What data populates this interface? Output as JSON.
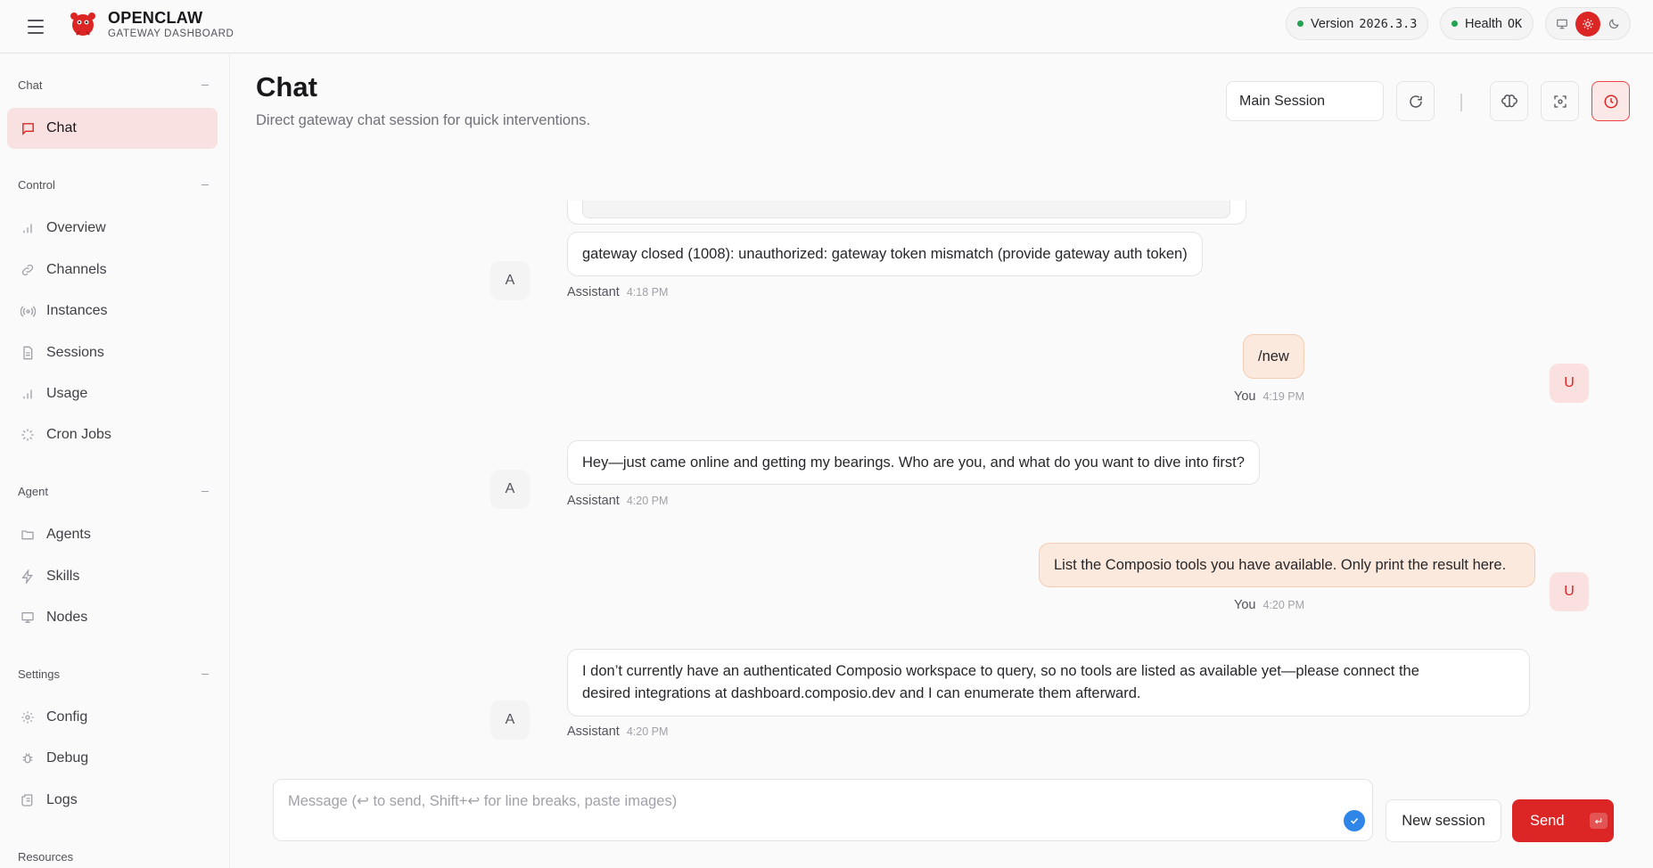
{
  "header": {
    "brand_title": "OPENCLAW",
    "brand_subtitle": "GATEWAY DASHBOARD",
    "version_label": "Version",
    "version_value": "2026.3.3",
    "health_label": "Health",
    "health_value": "OK",
    "status_color": "#22a352",
    "accent_color": "#dc2626",
    "theme_icons": [
      "monitor-icon",
      "sun-icon",
      "moon-icon"
    ]
  },
  "sidebar": {
    "sections": [
      {
        "title": "Chat",
        "items": [
          {
            "label": "Chat",
            "icon": "chat-bubble-icon",
            "active": true
          }
        ]
      },
      {
        "title": "Control",
        "items": [
          {
            "label": "Overview",
            "icon": "bar-chart-icon"
          },
          {
            "label": "Channels",
            "icon": "link-icon"
          },
          {
            "label": "Instances",
            "icon": "radio-icon"
          },
          {
            "label": "Sessions",
            "icon": "file-icon"
          },
          {
            "label": "Usage",
            "icon": "bar-chart-icon"
          },
          {
            "label": "Cron Jobs",
            "icon": "loader-icon"
          }
        ]
      },
      {
        "title": "Agent",
        "items": [
          {
            "label": "Agents",
            "icon": "folder-icon"
          },
          {
            "label": "Skills",
            "icon": "zap-icon"
          },
          {
            "label": "Nodes",
            "icon": "monitor-icon"
          }
        ]
      },
      {
        "title": "Settings",
        "items": [
          {
            "label": "Config",
            "icon": "gear-icon"
          },
          {
            "label": "Debug",
            "icon": "bug-icon"
          },
          {
            "label": "Logs",
            "icon": "scroll-icon"
          }
        ]
      },
      {
        "title": "Resources",
        "items": []
      }
    ]
  },
  "main": {
    "title": "Chat",
    "subtitle": "Direct gateway chat session for quick interventions.",
    "session_select": "Main Session",
    "toolbar_icons": [
      "refresh-icon",
      "brain-icon",
      "focus-icon",
      "clock-icon"
    ]
  },
  "messages": [
    {
      "role": "assistant",
      "avatar": "A",
      "text": "gateway closed (1008): unauthorized: gateway token mismatch (provide gateway auth token)",
      "sender": "Assistant",
      "time": "4:18 PM"
    },
    {
      "role": "user",
      "avatar": "U",
      "text": "/new",
      "sender": "You",
      "time": "4:19 PM"
    },
    {
      "role": "assistant",
      "avatar": "A",
      "text": "Hey—just came online and getting my bearings. Who are you, and what do you want to dive into first?",
      "sender": "Assistant",
      "time": "4:20 PM"
    },
    {
      "role": "user",
      "avatar": "U",
      "text": "List the Composio tools you have available. Only print the result here.",
      "sender": "You",
      "time": "4:20 PM"
    },
    {
      "role": "assistant",
      "avatar": "A",
      "text_line1": "I don’t currently have an authenticated Composio workspace to query, so no tools are listed as available yet—please connect the",
      "text_line2": "desired integrations at dashboard.composio.dev and I can enumerate them afterward.",
      "sender": "Assistant",
      "time": "4:20 PM"
    }
  ],
  "composer": {
    "placeholder": "Message (↩ to send, Shift+↩ for line breaks, paste images)",
    "new_session_label": "New session",
    "send_label": "Send"
  }
}
